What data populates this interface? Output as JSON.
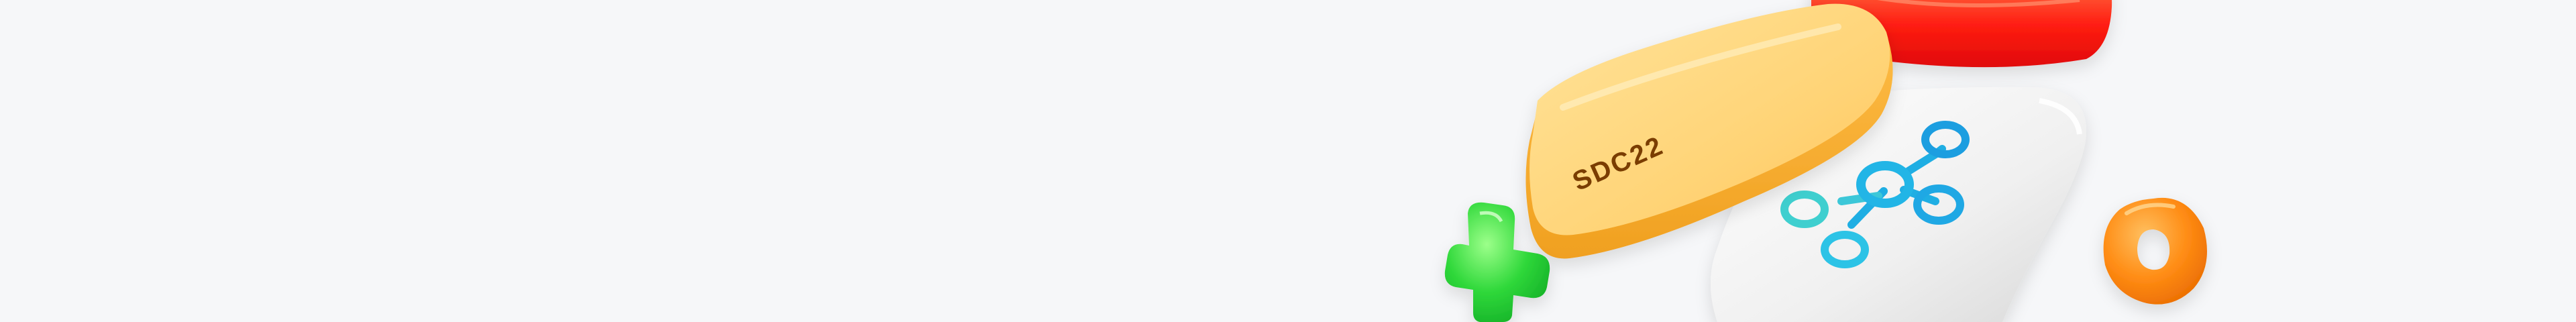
{
  "banner": {
    "pill_label": "SDC22"
  },
  "colors": {
    "background": "#f6f7f9",
    "yellow_pill": "#ffc85a",
    "red_shape": "#ff2a1a",
    "white_tile": "#f1f1f1",
    "blue_network": "#22b3e6",
    "green_plus": "#26d13a",
    "orange_ring": "#ff8a14"
  },
  "icons": [
    "red-rounded-shape-icon",
    "white-network-tile-icon",
    "network-nodes-icon",
    "yellow-pill-icon",
    "green-plus-icon",
    "orange-ring-icon"
  ]
}
